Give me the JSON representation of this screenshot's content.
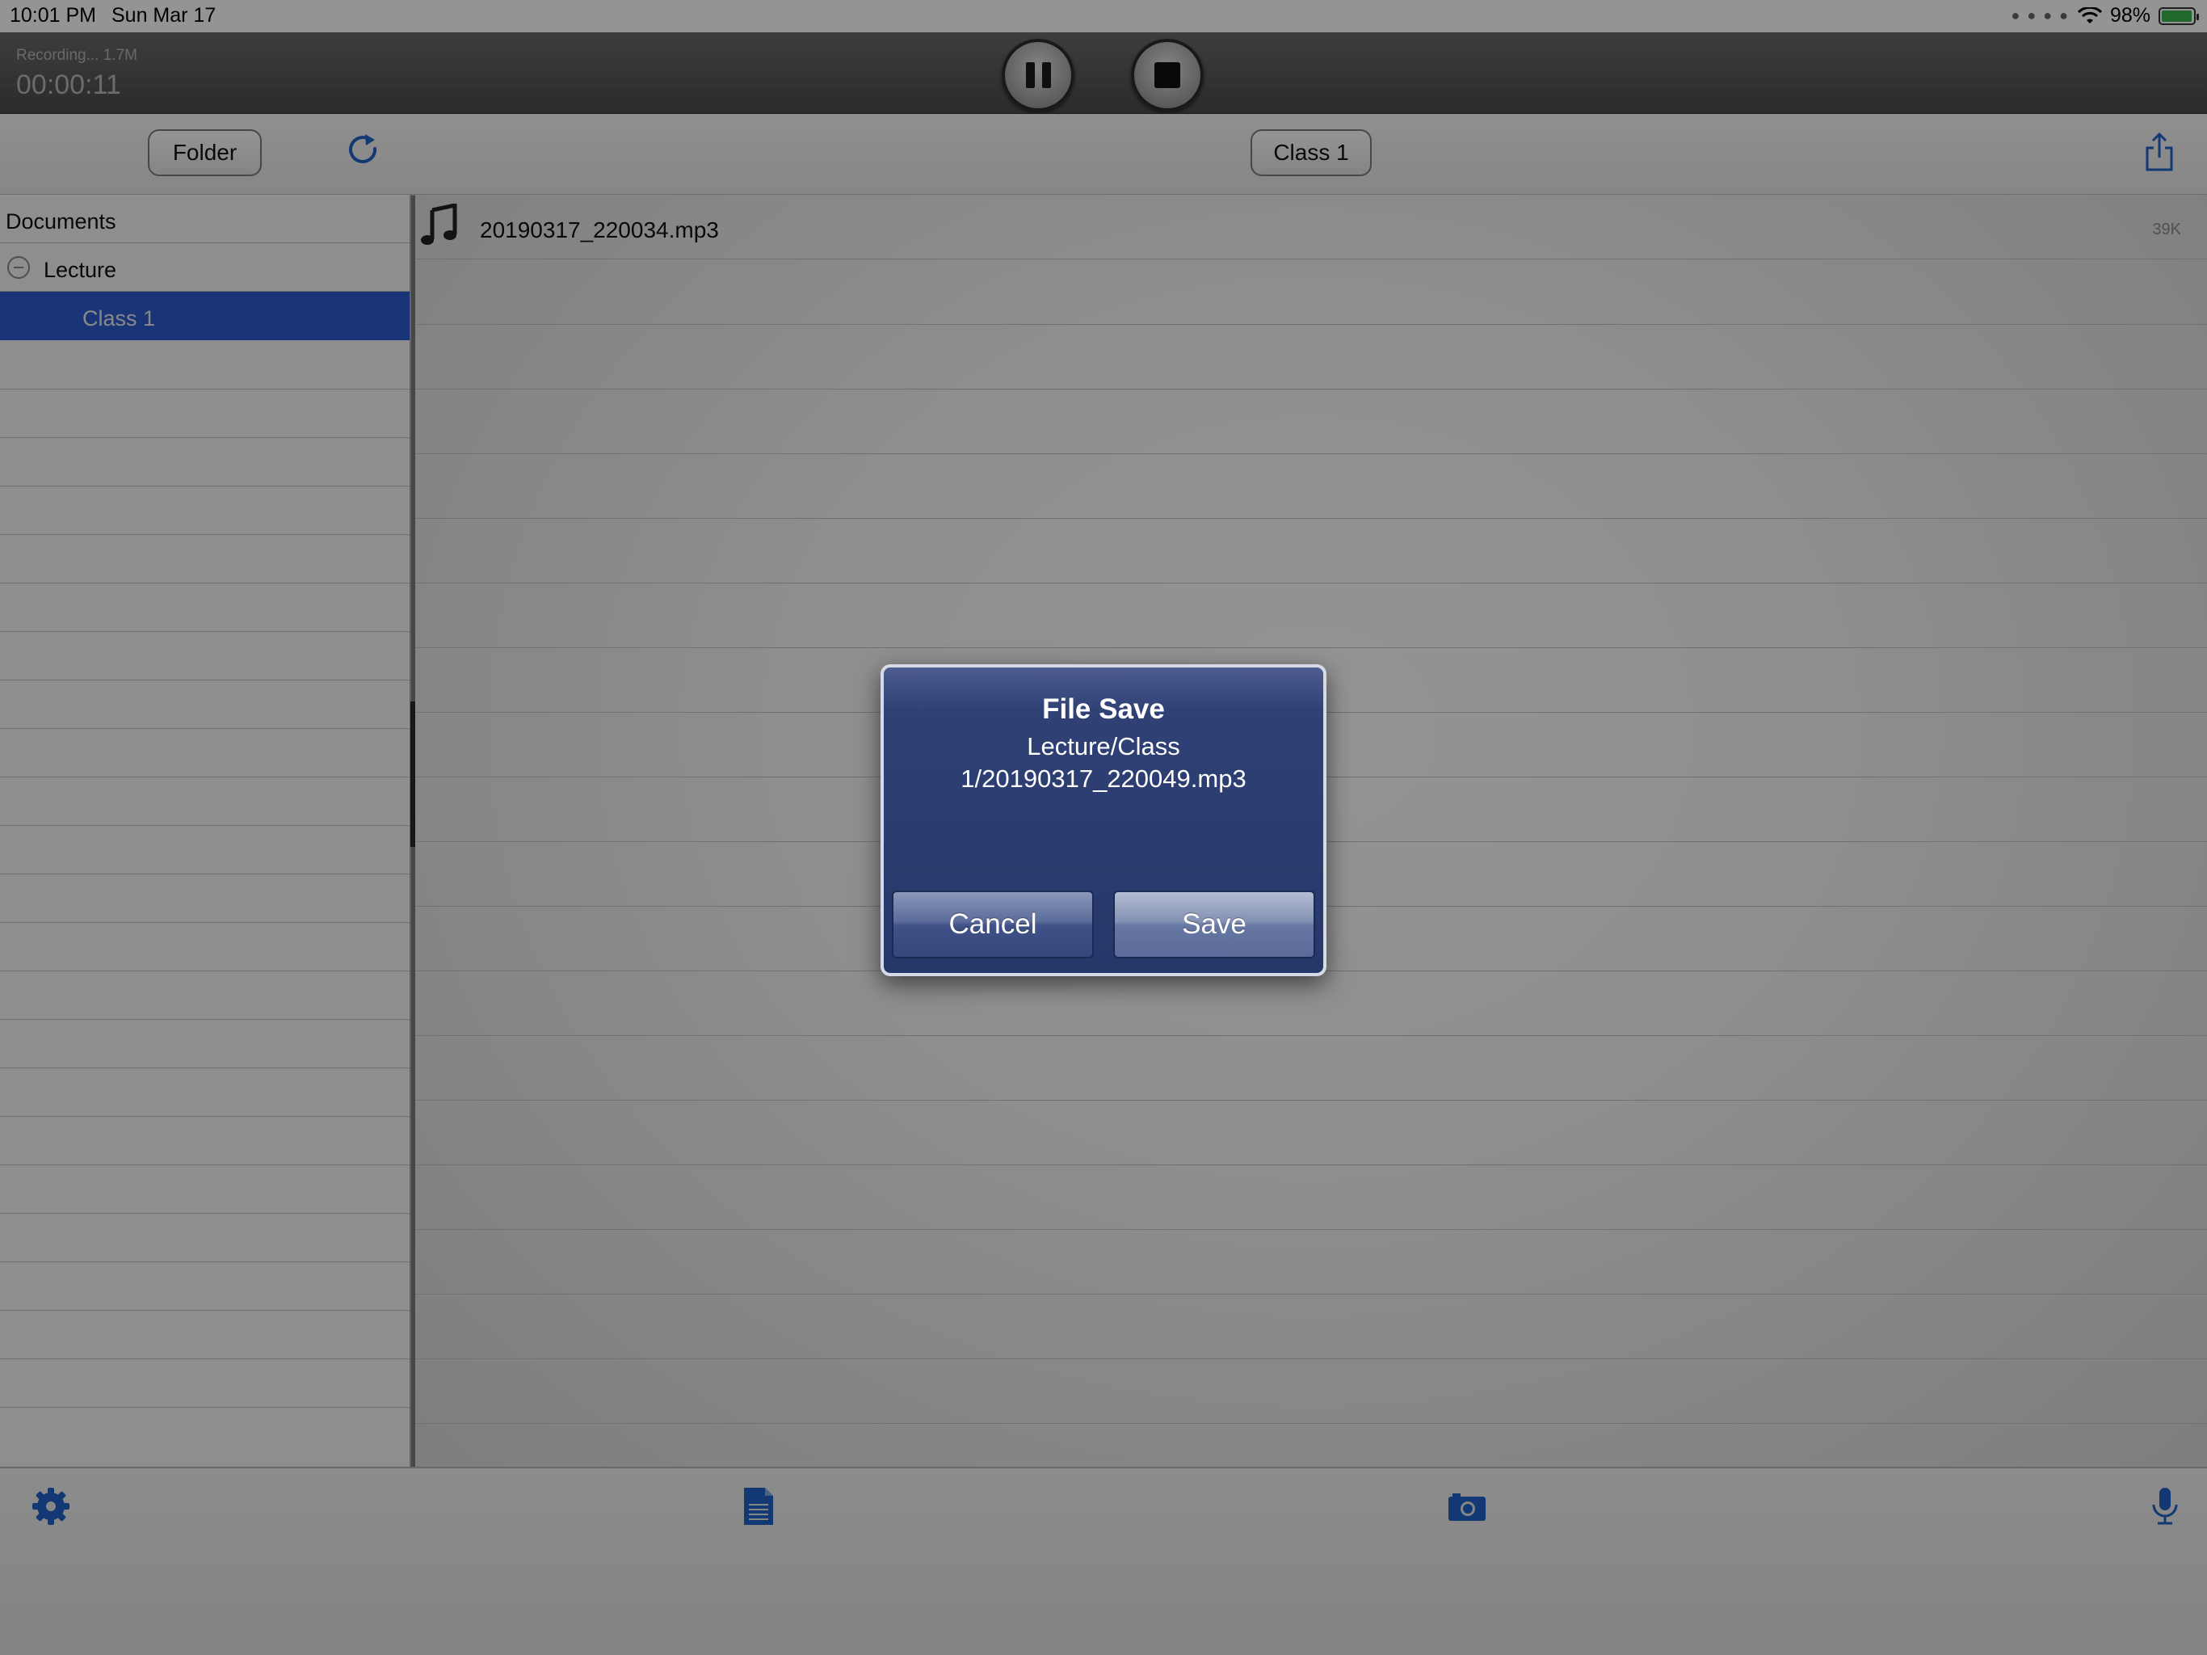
{
  "status_bar": {
    "time": "10:01 PM",
    "date": "Sun Mar 17",
    "battery": "98%"
  },
  "recorder": {
    "status": "Recording... 1.7M",
    "timer": "00:00:11",
    "pause_icon": "pause-icon",
    "stop_icon": "stop-icon"
  },
  "toolbar": {
    "folder_label": "Folder",
    "current_folder_label": "Class 1",
    "refresh_icon": "refresh-icon",
    "share_icon": "share-icon"
  },
  "tree": {
    "root": "Documents",
    "items": [
      {
        "label": "Lecture",
        "expanded": true
      },
      {
        "label": "Class 1",
        "selected": true
      }
    ]
  },
  "files": [
    {
      "name": "20190317_220034.mp3",
      "size": "39K"
    }
  ],
  "bottom_bar": {
    "icons": [
      "gear-icon",
      "document-icon",
      "camera-icon",
      "microphone-icon"
    ]
  },
  "dialog": {
    "title": "File Save",
    "message": "Lecture/Class 1/20190317_220049.mp3",
    "cancel_label": "Cancel",
    "save_label": "Save"
  },
  "colors": {
    "accent": "#2e5bcf",
    "icon_blue": "#1f63c9",
    "dialog_bg": "#2f4175"
  }
}
